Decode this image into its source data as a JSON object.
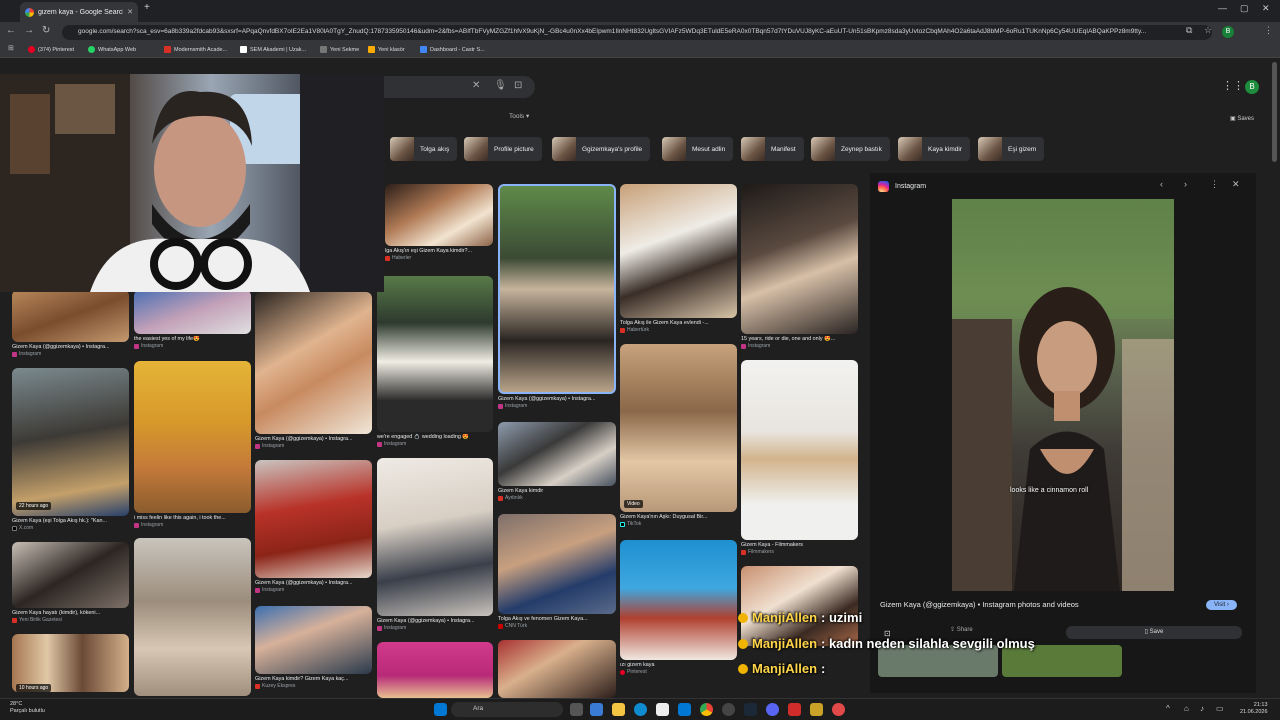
{
  "browser": {
    "tab_title": "gizem kaya - Google Search",
    "new_tab": "+",
    "minimize": "—",
    "maximize": "▢",
    "close": "✕",
    "url": "google.com/search?sca_esv=6a8b339a2fdcab93&sxsrf=APqaQnvfdBX7oIE2Ea1V80lA0TgY_ZnudQ:1787335950146&udm=2&fbs=ABIfTbFVyMZGZf1hfvX9uKjN_-GBc4u0nXx4bEIpwm1IlnNHt832UgltsGVIAFz5WDq3ETuldE5eRA0x0TBqn57d7tYDuVUJ8yKC-aEuUT-Un51sBKpmz8sda3yUvtozCbqMAh4O2a6taAdJ8bMP-6oRu1TUKnNp6Cy54UUEqIABQaKPPz8m9tty...",
    "profile_initial": "B",
    "bookmarks": [
      {
        "label": "(374) Pinterest",
        "color": "#e60023"
      },
      {
        "label": "WhatsApp Web",
        "color": "#25d366"
      },
      {
        "label": "Modernsmith Acade...",
        "color": "#d93025"
      },
      {
        "label": "SEM Akademi | Uzak...",
        "color": "#ffffff"
      },
      {
        "label": "Yeni Sekme",
        "color": "#888888"
      },
      {
        "label": "Yeni klasör",
        "color": "#f9ab00"
      },
      {
        "label": "Dashboard - Castr S...",
        "color": "#4285f4"
      }
    ]
  },
  "search": {
    "tools_label": "Tools",
    "saves_label": "Saves",
    "account_initial": "B",
    "chips": [
      "Tolga akış",
      "Profile picture",
      "Ggizemkaya's profile",
      "Mesut adlin",
      "Manifest",
      "Zeynep bastık",
      "Kaya kimdir",
      "Eşi gizem"
    ]
  },
  "results": [
    {
      "caption": "Gizem Kaya (@ggizemkaya) • Instagra...",
      "source": "Instagram",
      "badge": ""
    },
    {
      "caption": "the easiest yes of my life😍",
      "source": "Instagram",
      "badge": ""
    },
    {
      "caption": "lga Akış'ın eşi Gizem Kaya kimdir?...",
      "source": "Haberler",
      "badge": ""
    },
    {
      "caption": "Gizem Kaya (@ggizemkaya) • Instagra...",
      "source": "Instagram",
      "badge": ""
    },
    {
      "caption": "Tolga Akış ile Gizem Kaya evlendi -...",
      "source": "Habertürk",
      "badge": ""
    },
    {
      "caption": "15 years, ride or die, one and only 😍...",
      "source": "Instagram",
      "badge": ""
    },
    {
      "caption": "Gizem Kaya (eşi Tolga Akış hk.): \"Kan...",
      "source": "X.com",
      "badge": "22 hours ago"
    },
    {
      "caption": "i miss feelin like this again, i took the...",
      "source": "Instagram",
      "badge": ""
    },
    {
      "caption": "Gizem Kaya (@ggizemkaya) • Instagra...",
      "source": "Instagram",
      "badge": ""
    },
    {
      "caption": "we're engaged 💍 wedding loading 😍",
      "source": "Instagram",
      "badge": ""
    },
    {
      "caption": "Gizem Kaya kimdir",
      "source": "Aydınlık",
      "badge": ""
    },
    {
      "caption": "Gizem Kaya'nın Aşkı: Duygusal Bir...",
      "source": "TikTok",
      "badge": "Video"
    },
    {
      "caption": "Gizem Kaya - Filmmakers",
      "source": "Filmmakers",
      "badge": ""
    },
    {
      "caption": "Gizem Kaya hayatı (kimdir), kökeni...",
      "source": "Yeni Birlik Gazetesi",
      "badge": ""
    },
    {
      "caption": "Gizem Kaya (@ggizemkaya) • Instagra...",
      "source": "Instagram",
      "badge": ""
    },
    {
      "caption": "Gizem Kaya (@ggizemkaya) • Instagra...",
      "source": "Instagram",
      "badge": ""
    },
    {
      "caption": "Tolga Akış ve fenomen Gizem Kaya...",
      "source": "CNN Türk",
      "badge": ""
    },
    {
      "caption": "ızı gizem kaya",
      "source": "Pinterest",
      "badge": ""
    },
    {
      "caption": "Gizem Kaya kimdir? Gizem Kaya kaç...",
      "source": "Kuzey Ekspres",
      "badge": ""
    },
    {
      "caption": "",
      "source": "",
      "badge": "10 hours ago"
    }
  ],
  "preview": {
    "source_name": "Instagram",
    "image_text": "looks like a cinnamon roll",
    "title": "Gizem Kaya (@ggizemkaya) • Instagram photos and videos",
    "visit_label": "Visit ›",
    "share_label": "Share",
    "save_label": "Save"
  },
  "chat": [
    {
      "user": "ManjiAllen",
      "message": ": uzimi"
    },
    {
      "user": "ManjiAllen",
      "message": ": kadın neden silahla sevgili olmuş"
    },
    {
      "user": "ManjiAllen",
      "message": ":"
    }
  ],
  "taskbar": {
    "temperature": "28°C",
    "weather_desc": "Parçalı bulutlu",
    "search_label": "Ara",
    "time": "21:13",
    "date": "21.06.2026"
  },
  "colors": {
    "page_bg": "#1f1f1f",
    "chat_name": "#ffd54a",
    "visit_btn": "#8ab4f8"
  }
}
